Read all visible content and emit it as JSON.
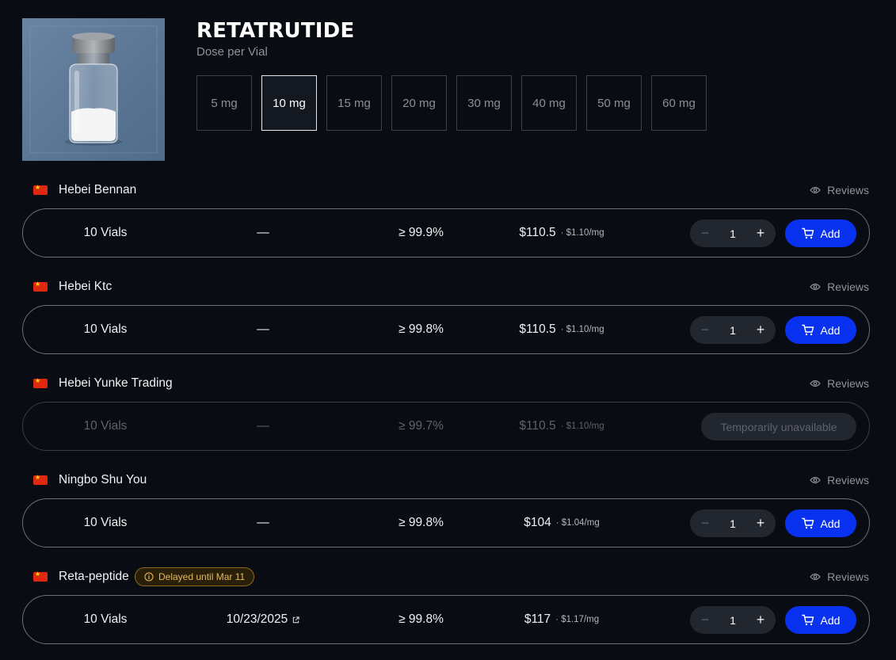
{
  "product": {
    "title": "RETATRUTIDE",
    "dose_label": "Dose per Vial",
    "image_icon": "vial-image",
    "doses": [
      "5 mg",
      "10 mg",
      "15 mg",
      "20 mg",
      "30 mg",
      "40 mg",
      "50 mg",
      "60 mg"
    ],
    "selected_dose": "10 mg"
  },
  "reviews_label": "Reviews",
  "accent_color": "#0832f0",
  "vendors": [
    {
      "name": "Hebei Bennan",
      "flag": "china-flag-icon",
      "offer": {
        "quantity": "10 Vials",
        "date": "—",
        "purity": "≥ 99.9%",
        "price": "$110.5",
        "per_mg": "· $1.10/mg",
        "qty_value": "1",
        "add_label": "Add"
      }
    },
    {
      "name": "Hebei Ktc",
      "flag": "china-flag-icon",
      "offer": {
        "quantity": "10 Vials",
        "date": "—",
        "purity": "≥ 99.8%",
        "price": "$110.5",
        "per_mg": "· $1.10/mg",
        "qty_value": "1",
        "add_label": "Add"
      }
    },
    {
      "name": "Hebei Yunke Trading",
      "flag": "china-flag-icon",
      "offer": {
        "quantity": "10 Vials",
        "date": "—",
        "purity": "≥ 99.7%",
        "price": "$110.5",
        "per_mg": "· $1.10/mg",
        "status": "Temporarily unavailable"
      }
    },
    {
      "name": "Ningbo Shu You",
      "flag": "china-flag-icon",
      "offer": {
        "quantity": "10 Vials",
        "date": "—",
        "purity": "≥ 99.8%",
        "price": "$104",
        "per_mg": "· $1.04/mg",
        "qty_value": "1",
        "add_label": "Add"
      }
    },
    {
      "name": "Reta-peptide",
      "flag": "china-flag-icon",
      "badge": "Delayed until Mar 11",
      "offer": {
        "quantity": "10 Vials",
        "date": "10/23/2025",
        "purity": "≥ 99.8%",
        "price": "$117",
        "per_mg": "· $1.17/mg",
        "qty_value": "1",
        "add_label": "Add"
      }
    }
  ]
}
